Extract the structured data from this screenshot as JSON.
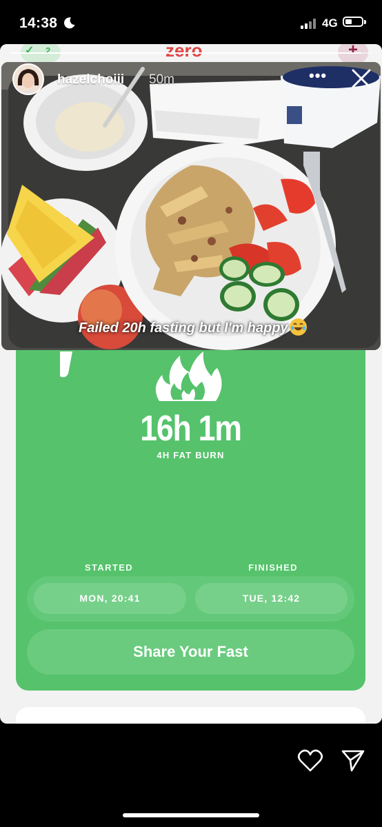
{
  "status_bar": {
    "time": "14:38",
    "network": "4G"
  },
  "app_behind": {
    "check_count": "2",
    "logo_text": "zero",
    "plus": "+"
  },
  "story": {
    "username": "hazelchoiii",
    "time_ago": "50m",
    "more": "•••",
    "progress": 0.97,
    "caption": "Failed 20h fasting but I'm happy"
  },
  "fast_card": {
    "duration": "16h 1m",
    "subtitle": "4H FAT BURN",
    "started_label": "STARTED",
    "finished_label": "FINISHED",
    "started_value": "MON, 20:41",
    "finished_value": "TUE, 12:42",
    "share_label": "Share Your Fast"
  },
  "colors": {
    "card_green": "#56c26c",
    "accent_red": "#e04545"
  },
  "icons": {
    "moon": "moon-icon",
    "heart": "heart-icon",
    "send": "send-icon",
    "close": "close-icon",
    "flame": "flame-icon"
  }
}
